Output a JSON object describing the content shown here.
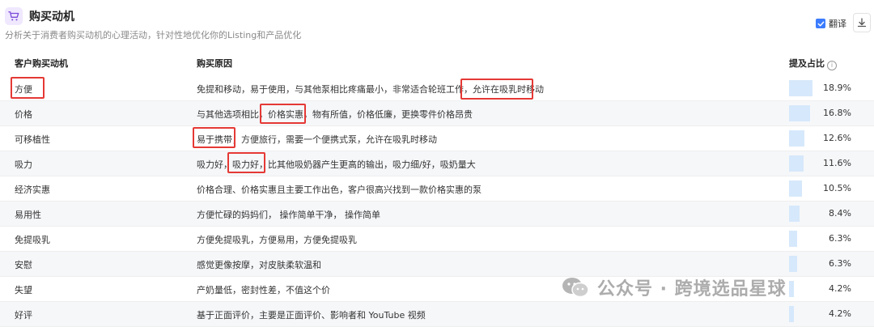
{
  "header": {
    "title": "购买动机",
    "subtitle": "分析关于消费者购买动机的心理活动，针对性地优化你的Listing和产品优化",
    "translate_label": "翻译",
    "translate_checked": true
  },
  "table": {
    "columns": [
      "客户购买动机",
      "购买原因",
      "提及占比"
    ],
    "rows": [
      {
        "name": "方便",
        "reason": "免提和移动，易于使用，与其他泵相比疼痛最小，非常适合轮班工作，允许在吸乳时移动",
        "percent": "18.9%",
        "share": 18.9
      },
      {
        "name": "价格",
        "reason": "与其他选项相比，价格实惠，物有所值，价格低廉，更换零件价格昂贵",
        "percent": "16.8%",
        "share": 16.8
      },
      {
        "name": "可移植性",
        "reason": "易于携带，方便旅行，需要一个便携式泵，允许在吸乳时移动",
        "percent": "12.6%",
        "share": 12.6
      },
      {
        "name": "吸力",
        "reason": "吸力好，吸力好，比其他吸奶器产生更高的输出，吸力细/好，吸奶量大",
        "percent": "11.6%",
        "share": 11.6
      },
      {
        "name": "经济实惠",
        "reason": "价格合理、价格实惠且主要工作出色，客户很高兴找到一款价格实惠的泵",
        "percent": "10.5%",
        "share": 10.5
      },
      {
        "name": "易用性",
        "reason": "方便忙碌的妈妈们， 操作简单干净， 操作简单",
        "percent": "8.4%",
        "share": 8.4
      },
      {
        "name": "免提吸乳",
        "reason": "方便免提吸乳，方便易用，方便免提吸乳",
        "percent": "6.3%",
        "share": 6.3
      },
      {
        "name": "安慰",
        "reason": "感觉更像按摩，对皮肤柔软温和",
        "percent": "6.3%",
        "share": 6.3
      },
      {
        "name": "失望",
        "reason": "产奶量低，密封性差，不值这个价",
        "percent": "4.2%",
        "share": 4.2
      },
      {
        "name": "好评",
        "reason": "基于正面评价，主要是正面评价、影响者和 YouTube 视频",
        "percent": "4.2%",
        "share": 4.2
      }
    ]
  },
  "watermark": {
    "text": "公众号 · 跨境选品星球"
  },
  "colors": {
    "accent": "#3b7cff",
    "bar": "#d6e8fb",
    "highlight": "#e53935",
    "cart_icon": "#7b4bd8"
  }
}
